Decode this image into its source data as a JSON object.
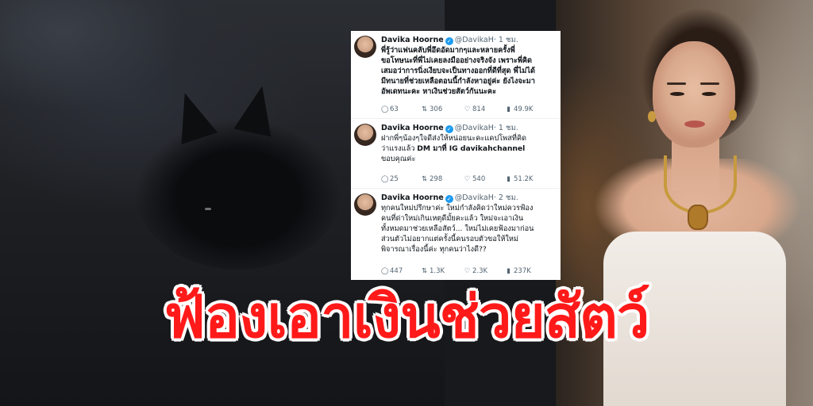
{
  "tweets": [
    {
      "name": "Davika Hoorne",
      "handle": "@DavikaH",
      "time": "· 1 ชม.",
      "lines": [
        "พี่รู้ว่าแฟนคลับพี่อึดอัดมากๆและหลายครั้งพี่",
        "ขอโทษนะที่พี่ไม่เคยลงมืออย่างจริงจัง เพราะพี่คิด",
        "เสมอว่าการนิ่งเงียบจะเป็นทางออกที่ดีที่สุด พี่ไม่ได้",
        "มีทนายที่ช่วยเหลือตอนนี้กำลังหาอยู่ค่ะ ยังไงจะมา",
        "อัพเดทนะคะ หาเงินช่วยสัตว์กันนะคะ"
      ],
      "replies": "63",
      "retweets": "306",
      "likes": "814",
      "views": "49.9K"
    },
    {
      "name": "Davika Hoorne",
      "handle": "@DavikaH",
      "time": "· 1 ชม.",
      "line1": "ฝากพี่ๆน้องๆใจดีส่งให้หน่อยนะคะแคปโพสที่คิด",
      "line2_pre": "ว่าแรงแล้ว ",
      "line2_bold": "DM มาที่ IG davikahchannel",
      "line3": "ขอบคุณค่ะ",
      "replies": "25",
      "retweets": "298",
      "likes": "540",
      "views": "51.2K"
    },
    {
      "name": "Davika Hoorne",
      "handle": "@DavikaH",
      "time": "· 2 ชม.",
      "lines": [
        "ทุกคนใหม่ปรึกษาค่ะ ใหม่กำลังคิดว่าใหม่ควรฟ้อง",
        "คนที่ด่าใหม่เกินเหตุดีมั้ยคะแล้ว ใหม่จะเอาเงิน",
        "ทั้งหมดมาช่วยเหลือสัตว์... ใหม่ไม่เคยฟ้องมาก่อน",
        "ส่วนตัวไม่อยากแต่ครั้งนี้คนรอบตัวขอให้ใหม่",
        "พิจารณาเรื่องนี้ค่ะ ทุกคนว่าไงดี??"
      ],
      "replies": "447",
      "retweets": "1.3K",
      "likes": "2.3K",
      "views": "237K"
    }
  ],
  "icons": {
    "reply": "comment-icon",
    "retweet": "retweet-icon",
    "like": "heart-icon",
    "views": "views-icon",
    "verified": "verified-badge-icon"
  },
  "headline": "ฟ้องเอาเงินช่วยสัตว์",
  "colors": {
    "headline": "#ff1a1a",
    "verified": "#1d9bf0"
  }
}
